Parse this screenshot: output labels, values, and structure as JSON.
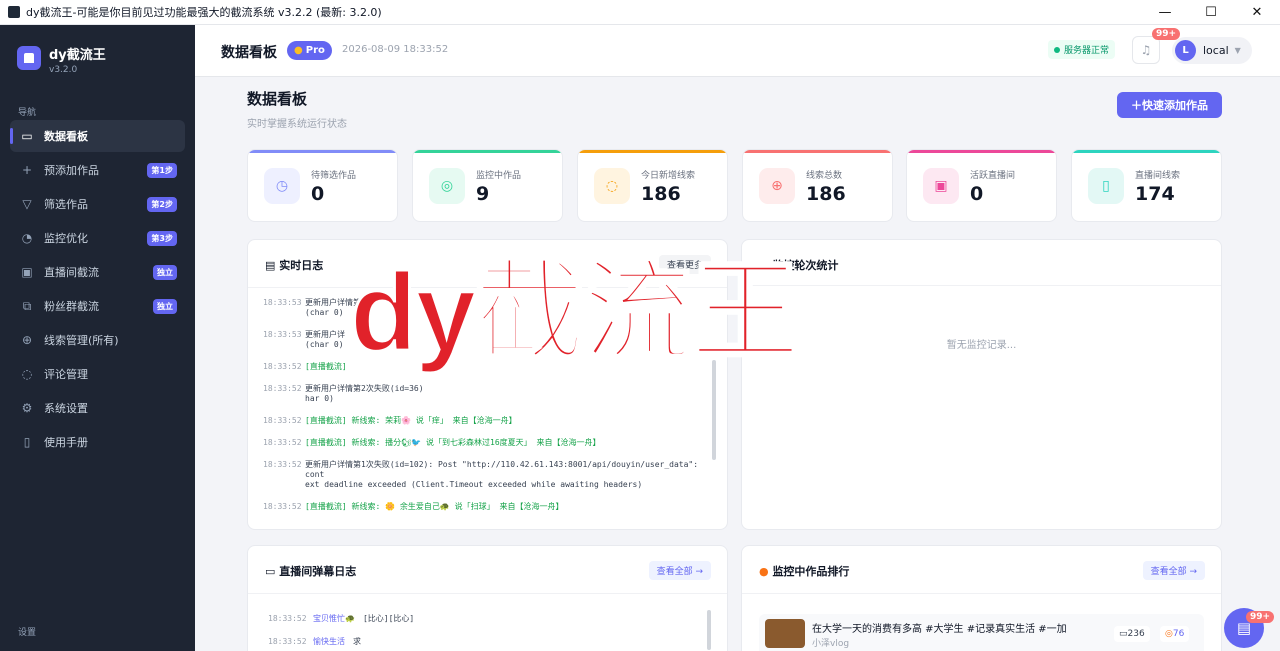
{
  "window": {
    "title": "dy截流王-可能是你目前见过功能最强大的截流系统 v3.2.2 (最新: 3.2.0)",
    "min": "—",
    "max": "☐",
    "close": "✕"
  },
  "sidebar": {
    "brand_name": "dy截流王",
    "brand_version": "v3.2.0",
    "section_nav": "导航",
    "section_settings": "设置",
    "items": [
      {
        "label": "数据看板",
        "icon": "dashboard-icon",
        "glyph": "▭",
        "badge": ""
      },
      {
        "label": "预添加作品",
        "icon": "plus-icon",
        "glyph": "+",
        "badge": "第1步"
      },
      {
        "label": "筛选作品",
        "icon": "filter-icon",
        "glyph": "▽",
        "badge": "第2步"
      },
      {
        "label": "监控优化",
        "icon": "gauge-icon",
        "glyph": "◔",
        "badge": "第3步"
      },
      {
        "label": "直播间截流",
        "icon": "video-icon",
        "glyph": "▣",
        "badge": "独立"
      },
      {
        "label": "粉丝群截流",
        "icon": "group-icon",
        "glyph": "⧉",
        "badge": "独立"
      },
      {
        "label": "线索管理(所有)",
        "icon": "target-icon",
        "glyph": "⊕",
        "badge": ""
      },
      {
        "label": "评论管理",
        "icon": "comment-icon",
        "glyph": "◌",
        "badge": ""
      },
      {
        "label": "系统设置",
        "icon": "gear-icon",
        "glyph": "⚙",
        "badge": ""
      },
      {
        "label": "使用手册",
        "icon": "book-icon",
        "glyph": "▯",
        "badge": ""
      }
    ]
  },
  "header": {
    "title": "数据看板",
    "pro_badge": "Pro",
    "datetime": "2026-08-09 18:33:52",
    "server_status": "服务器正常",
    "notification_count": "99+",
    "user_initial": "L",
    "user_name": "local"
  },
  "main": {
    "title": "数据看板",
    "subtitle": "实时掌握系统运行状态",
    "quick_add": "＋快速添加作品"
  },
  "stats": [
    {
      "label": "待筛选作品",
      "value": "0",
      "color": "#818cf8",
      "bg": "#eef0ff",
      "glyph": "◷"
    },
    {
      "label": "监控中作品",
      "value": "9",
      "color": "#34d399",
      "bg": "#e6faf2",
      "glyph": "◎"
    },
    {
      "label": "今日新增线索",
      "value": "186",
      "color": "#f59e0b",
      "bg": "#fff4e0",
      "glyph": "◌"
    },
    {
      "label": "线索总数",
      "value": "186",
      "color": "#f87171",
      "bg": "#feecec",
      "glyph": "⊕"
    },
    {
      "label": "活跃直播间",
      "value": "0",
      "color": "#ec4899",
      "bg": "#fde8f2",
      "glyph": "▣"
    },
    {
      "label": "直播间线索",
      "value": "174",
      "color": "#2dd4bf",
      "bg": "#e3f8f5",
      "glyph": "▯"
    }
  ],
  "realtime_log": {
    "title": "实时日志",
    "more": "查看更多",
    "lines": [
      {
        "time": "18:33:53",
        "msg": "更新用户详情第",
        "extra": "(char 0)",
        "green": false
      },
      {
        "time": "18:33:53",
        "msg": "更新用户详",
        "extra": "(char 0)",
        "green": false
      },
      {
        "time": "18:33:52",
        "msg": "[直播截流]",
        "extra": "",
        "green": true
      },
      {
        "time": "18:33:52",
        "msg": "更新用户详情第2次失败(id=36)",
        "extra": "har 0)",
        "green": false
      },
      {
        "time": "18:33:52",
        "msg": "[直播截流] 新线索: 荣莉🌸 说「痒」 来自【沧海一舟】",
        "extra": "",
        "green": true
      },
      {
        "time": "18:33:52",
        "msg": "[直播截流] 新线索: 播分🐿🐦 说「到七彩森林过16度夏天」 来自【沧海一舟】",
        "extra": "",
        "green": true
      },
      {
        "time": "18:33:52",
        "msg": "更新用户详情第1次失败(id=102): Post \"http://110.42.61.143:8001/api/douyin/user_data\": cont",
        "extra": "ext deadline exceeded (Client.Timeout exceeded while awaiting headers)",
        "green": false
      },
      {
        "time": "18:33:52",
        "msg": "[直播截流] 新线索: 🌼 余生爱自己🐢 说「扫球」 来自【沧海一舟】",
        "extra": "",
        "green": true
      }
    ]
  },
  "monitor_stats": {
    "title": "监控轮次统计",
    "empty": "暂无监控记录..."
  },
  "danmaku_log": {
    "title": "直播间弹幕日志",
    "more": "查看全部 →",
    "lines": [
      {
        "time": "18:33:52",
        "user": "宝贝惟忙🐢",
        "msg": "[比心][比心]"
      },
      {
        "time": "18:33:52",
        "user": "愉快生活",
        "msg": "求"
      }
    ]
  },
  "ranking": {
    "title": "监控中作品排行",
    "more": "查看全部 →",
    "items": [
      {
        "title": "在大学一天的消费有多高 #大学生 #记录真实生活 #一加",
        "author": "小泽vlog",
        "comments": "236",
        "leads": "76"
      }
    ]
  },
  "overlay_text": "dy截流王",
  "fab": {
    "badge": "99+"
  }
}
